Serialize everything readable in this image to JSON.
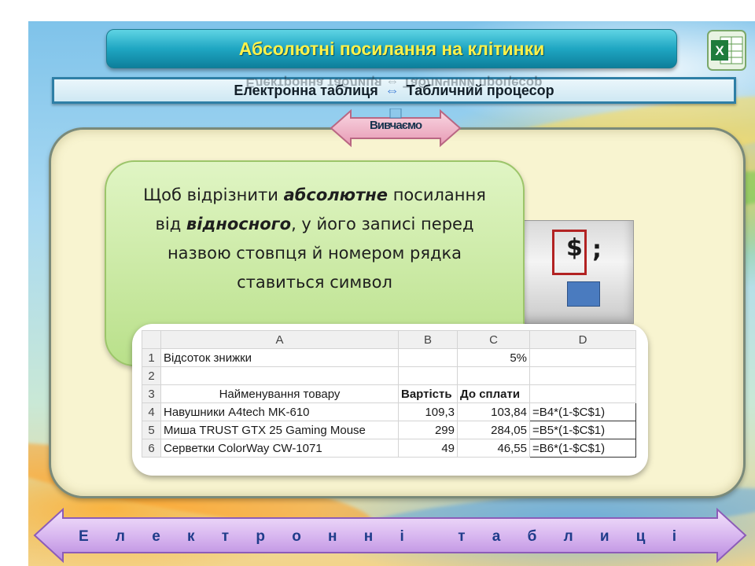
{
  "title": "Абсолютні посилання на клітинки",
  "subtitle": {
    "left": "Електронна таблиця",
    "arrow": "⇔",
    "right": "Табличний процесор"
  },
  "badge": "Вивчаємо",
  "explanation": {
    "part1": "Щоб відрізнити ",
    "bold1": "абсолютне",
    "part2": " посилання від ",
    "bold2": "відносного",
    "part3": ", у його записі перед назвою стовпця й номером рядка ставиться символ"
  },
  "key": {
    "symbol": "$",
    "semicolon": ";"
  },
  "spreadsheet": {
    "columns": [
      "",
      "A",
      "B",
      "C",
      "D"
    ],
    "rows": [
      {
        "n": "1",
        "a": "Відсоток знижки",
        "b": "",
        "c": "5%",
        "d": ""
      },
      {
        "n": "2",
        "a": "",
        "b": "",
        "c": "",
        "d": ""
      },
      {
        "n": "3",
        "a": "Найменування товару",
        "b": "Вартість",
        "c": "До сплати",
        "d": ""
      },
      {
        "n": "4",
        "a": "Навушники A4tech MK-610",
        "b": "109,3",
        "c": "103,84",
        "d": "=B4*(1-$C$1)"
      },
      {
        "n": "5",
        "a": "Миша TRUST GTX 25 Gaming Mouse",
        "b": "299",
        "c": "284,05",
        "d": "=B5*(1-$C$1)"
      },
      {
        "n": "6",
        "a": "Серветки ColorWay CW-1071",
        "b": "49",
        "c": "46,55",
        "d": "=B6*(1-$C$1)"
      }
    ]
  },
  "footer": {
    "letters": [
      "Е",
      "л",
      "е",
      "к",
      "т",
      "р",
      "о",
      "н",
      "н",
      "і",
      " ",
      "т",
      "а",
      "б",
      "л",
      "и",
      "ц",
      "і"
    ]
  }
}
